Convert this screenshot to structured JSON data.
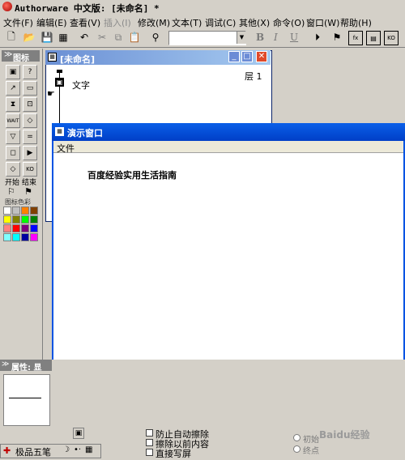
{
  "app": {
    "title": "Authorware 中文版: [未命名] *"
  },
  "menu": [
    "文件(F)",
    "编辑(E)",
    "查看(V)",
    "插入(I)",
    "修改(M)",
    "文本(T)",
    "调试(C)",
    "其他(X)",
    "命令(O)",
    "窗口(W)",
    "帮助(H)"
  ],
  "toolbar": {
    "font_combo_value": "",
    "bold": "B",
    "italic": "I",
    "underline": "U"
  },
  "icon_palette": {
    "title": "图标",
    "start_label": "开始",
    "end_label": "结束",
    "color_label": "图标色彩",
    "swatches": [
      "#ffffff",
      "#c0c0c0",
      "#ff8000",
      "#804000",
      "#ffff00",
      "#808000",
      "#00ff00",
      "#008000",
      "#ff8080",
      "#ff0000",
      "#800080",
      "#0000ff",
      "#80ffff",
      "#00ffff",
      "#0000a0",
      "#ff00ff"
    ]
  },
  "flow_window": {
    "title": "[未命名]",
    "layer": "层 1",
    "icon_label": "文字"
  },
  "demo_window": {
    "title": "演示窗口",
    "menu_file": "文件",
    "text": "百度经验实用生活指南"
  },
  "properties": {
    "title": "属性: 显",
    "options": [
      "防止自动擦除",
      "擦除以前内容",
      "直接写屏"
    ],
    "radio_a": "初始",
    "radio_b": "终点"
  },
  "taskbar": {
    "ime_label": "极品五笔"
  },
  "watermark": "Baidu经验"
}
